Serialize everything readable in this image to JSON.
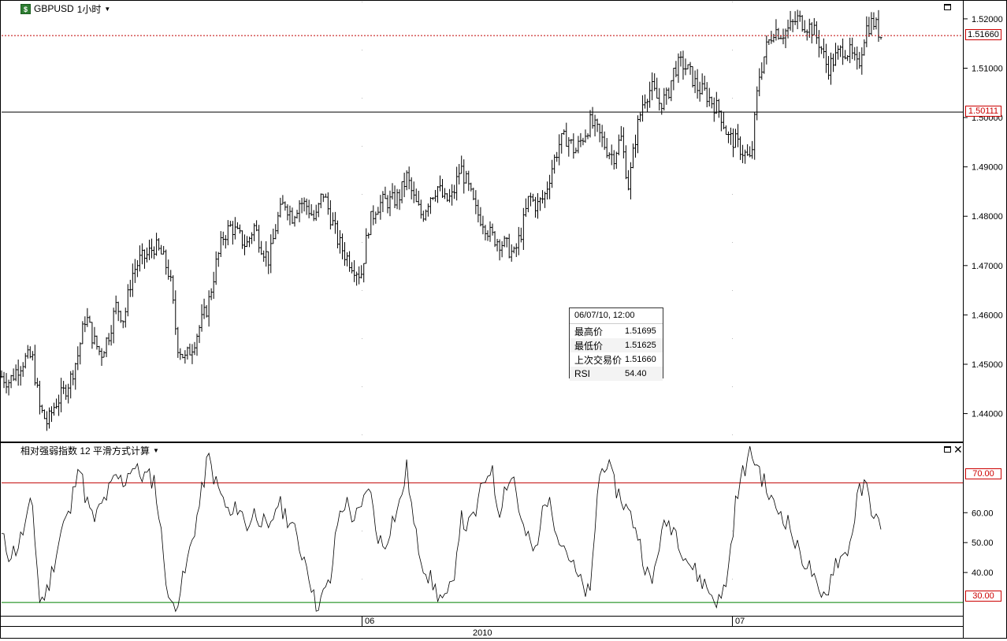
{
  "header": {
    "symbol": "GBPUSD",
    "timeframe": "1小时",
    "symbol_icon": "forex-icon",
    "maximize_icon": "maximize-icon"
  },
  "rsi_panel": {
    "title": "相对强弱指数 12 平滑方式计算",
    "maximize_icon": "maximize-icon",
    "close_icon": "close-icon",
    "close_glyph": "✕"
  },
  "tooltip": {
    "datetime": "06/07/10, 12:00",
    "rows": [
      {
        "label": "最高价",
        "value": "1.51695"
      },
      {
        "label": "最低价",
        "value": "1.51625"
      },
      {
        "label": "上次交易价",
        "value": "1.51660"
      },
      {
        "label": "RSI",
        "value": "54.40"
      }
    ]
  },
  "price_tags": {
    "last_price": "1.51660",
    "horizontal_line": "1.50111"
  },
  "rsi_tags": {
    "upper": "70.00",
    "lower": "30.00"
  },
  "colors": {
    "bars": "#000000",
    "last_price_line": "#c00000",
    "overbought_line": "#c00000",
    "oversold_line": "#008000",
    "symbol_icon_bg": "#2e7d32"
  },
  "chart_data": [
    {
      "type": "ohlc",
      "series": [
        {
          "name": "GBPUSD"
        }
      ],
      "ylim": [
        1.4345,
        1.5235
      ],
      "yticks": [
        "1.52000",
        "1.51000",
        "1.50000",
        "1.49000",
        "1.48000",
        "1.47000",
        "1.46000",
        "1.45000",
        "1.44000"
      ],
      "ytick_values": [
        1.52,
        1.51,
        1.5,
        1.49,
        1.48,
        1.47,
        1.46,
        1.45,
        1.44
      ],
      "horizontal_lines": [
        {
          "value": 1.5166,
          "style": "dotted",
          "label": "1.51660"
        },
        {
          "value": 1.50111,
          "style": "solid",
          "label": "1.50111"
        }
      ],
      "x_month_labels": [
        "06",
        "07"
      ],
      "x_year_label": "2010",
      "bar_count": 370,
      "close_path": [
        1.4475,
        1.4465,
        1.449,
        1.451,
        1.4515,
        1.441,
        1.438,
        1.442,
        1.444,
        1.447,
        1.452,
        1.46,
        1.455,
        1.452,
        1.456,
        1.462,
        1.459,
        1.468,
        1.471,
        1.472,
        1.474,
        1.472,
        1.468,
        1.454,
        1.451,
        1.454,
        1.458,
        1.462,
        1.47,
        1.476,
        1.478,
        1.476,
        1.474,
        1.478,
        1.474,
        1.471,
        1.479,
        1.483,
        1.48,
        1.483,
        1.482,
        1.479,
        1.485,
        1.48,
        1.475,
        1.472,
        1.47,
        1.468,
        1.478,
        1.482,
        1.483,
        1.483,
        1.484,
        1.488,
        1.483,
        1.48,
        1.484,
        1.486,
        1.483,
        1.484,
        1.49,
        1.486,
        1.481,
        1.479,
        1.476,
        1.475,
        1.474,
        1.472,
        1.477,
        1.484,
        1.482,
        1.484,
        1.49,
        1.495,
        1.496,
        1.493,
        1.496,
        1.499,
        1.497,
        1.494,
        1.492,
        1.496,
        1.486,
        1.497,
        1.504,
        1.506,
        1.503,
        1.504,
        1.51,
        1.511,
        1.509,
        1.506,
        1.505,
        1.503,
        1.501,
        1.496,
        1.495,
        1.493,
        1.491,
        1.508,
        1.514,
        1.518,
        1.517,
        1.518,
        1.52,
        1.519,
        1.518,
        1.515,
        1.51,
        1.512,
        1.514,
        1.513,
        1.51,
        1.518,
        1.5195,
        1.5166
      ]
    },
    {
      "type": "line",
      "series": [
        {
          "name": "相对强弱指数 12 平滑方式计算"
        }
      ],
      "ylim": [
        25.8,
        83.0
      ],
      "yticks": [
        "70.00",
        "60.00",
        "50.00",
        "40.00",
        "30.00"
      ],
      "ytick_values": [
        70,
        60,
        50,
        40,
        30
      ],
      "horizontal_lines": [
        {
          "value": 70,
          "label": "70.00"
        },
        {
          "value": 30,
          "label": "30.00"
        }
      ],
      "last_value": 54.4,
      "values_path": [
        52,
        46,
        48,
        55,
        64,
        30,
        34,
        45,
        56,
        60,
        78,
        65,
        57,
        62,
        67,
        72,
        70,
        76,
        73,
        72,
        71,
        50,
        28,
        31,
        40,
        52,
        64,
        79,
        70,
        64,
        58,
        63,
        55,
        60,
        58,
        52,
        64,
        60,
        56,
        48,
        43,
        29,
        32,
        37,
        58,
        64,
        58,
        60,
        70,
        54,
        48,
        57,
        62,
        75,
        54,
        44,
        38,
        33,
        30,
        36,
        58,
        55,
        60,
        70,
        76,
        60,
        70,
        72,
        56,
        50,
        46,
        66,
        60,
        52,
        47,
        40,
        35,
        32,
        70,
        78,
        70,
        65,
        60,
        55,
        44,
        35,
        50,
        57,
        55,
        48,
        43,
        39,
        36,
        32,
        30,
        40,
        63,
        74,
        80,
        75,
        68,
        62,
        60,
        56,
        48,
        44,
        40,
        30,
        34,
        44,
        45,
        50,
        66,
        69,
        60,
        54
      ]
    }
  ]
}
